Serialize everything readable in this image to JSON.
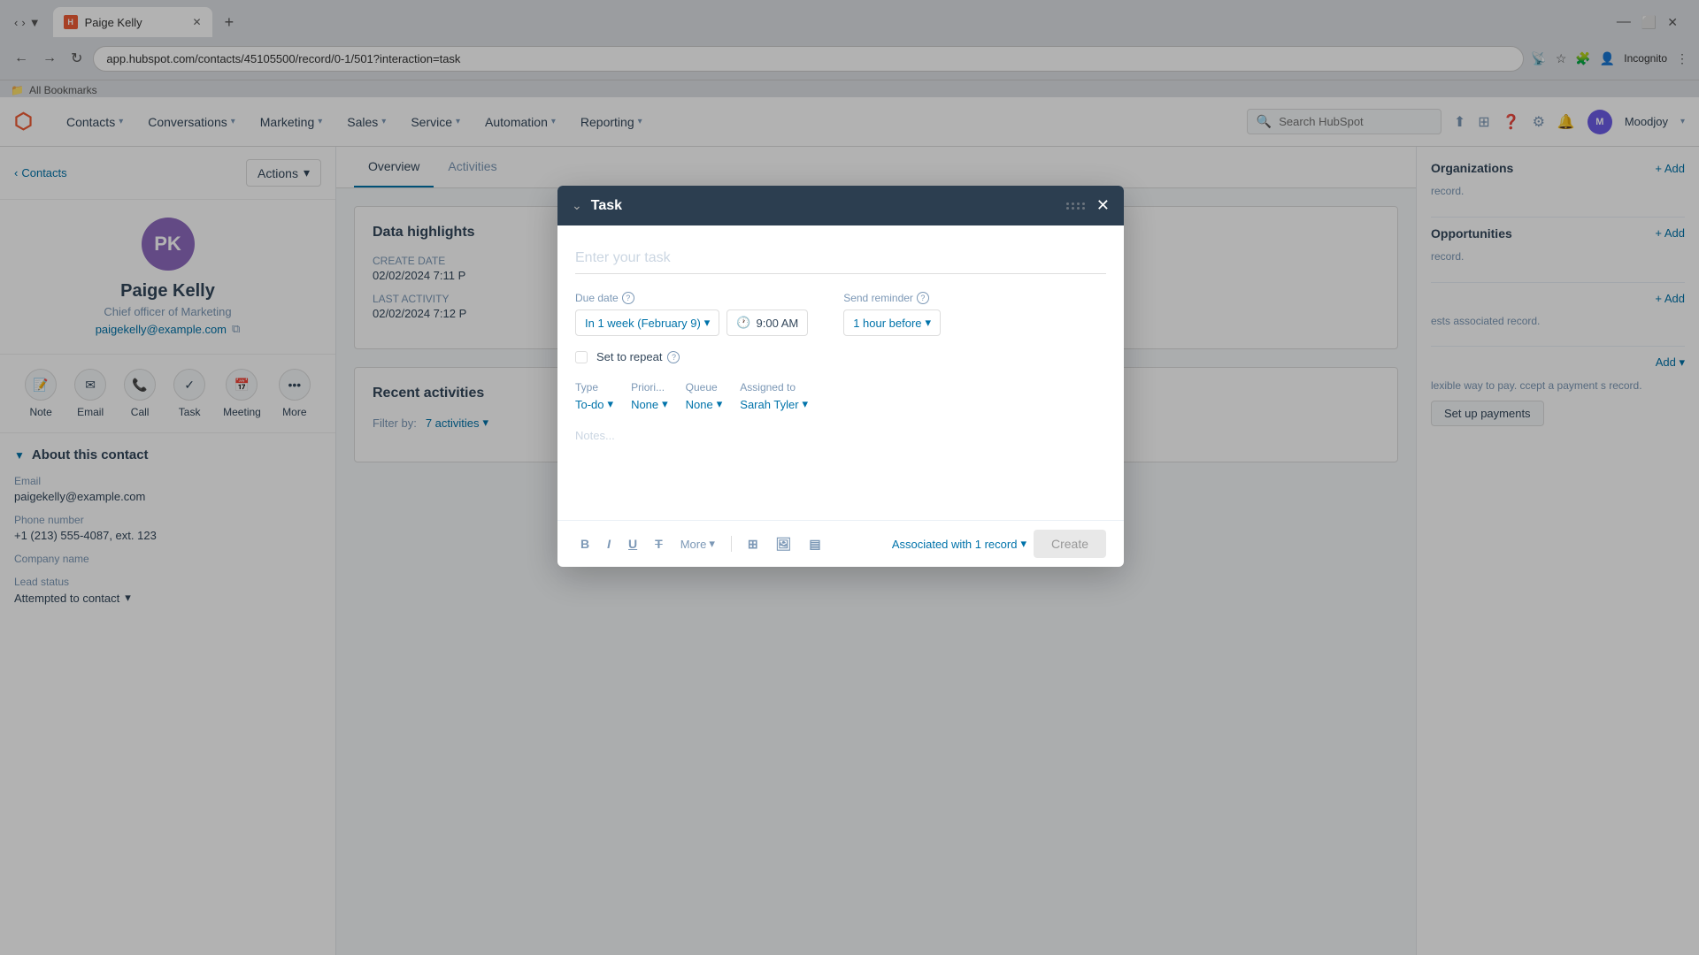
{
  "browser": {
    "tab_title": "Paige Kelly",
    "url": "app.hubspot.com/contacts/45105500/record/0-1/501?interaction=task",
    "new_tab_symbol": "+",
    "incognito_label": "Incognito",
    "bookmarks_label": "All Bookmarks"
  },
  "nav": {
    "logo": "⬡",
    "items": [
      {
        "label": "Contacts",
        "id": "contacts"
      },
      {
        "label": "Conversations",
        "id": "conversations"
      },
      {
        "label": "Marketing",
        "id": "marketing"
      },
      {
        "label": "Sales",
        "id": "sales"
      },
      {
        "label": "Service",
        "id": "service"
      },
      {
        "label": "Automation",
        "id": "automation"
      },
      {
        "label": "Reporting",
        "id": "reporting"
      }
    ],
    "search_placeholder": "Search HubSpot",
    "user_initials": "M",
    "user_name": "Moodjoy"
  },
  "sidebar": {
    "back_label": "Contacts",
    "actions_label": "Actions",
    "contact": {
      "initials": "PK",
      "name": "Paige Kelly",
      "title": "Chief officer of Marketing",
      "email": "paigekelly@example.com"
    },
    "quick_actions": [
      {
        "id": "note",
        "label": "Note",
        "icon": "📝"
      },
      {
        "id": "email",
        "label": "Email",
        "icon": "✉"
      },
      {
        "id": "call",
        "label": "Call",
        "icon": "📞"
      },
      {
        "id": "task",
        "label": "Task",
        "icon": "✓"
      },
      {
        "id": "meeting",
        "label": "Meeting",
        "icon": "📅"
      },
      {
        "id": "more",
        "label": "More",
        "icon": "•••"
      }
    ],
    "about_title": "About this contact",
    "fields": [
      {
        "label": "Email",
        "value": "paigekelly@example.com"
      },
      {
        "label": "Phone number",
        "value": "+1 (213) 555-4087, ext. 123"
      },
      {
        "label": "Company name",
        "value": ""
      },
      {
        "label": "Lead status",
        "value": "Attempted to contact"
      }
    ]
  },
  "main": {
    "tabs": [
      {
        "label": "Overview",
        "active": true
      },
      {
        "label": "Activities",
        "active": false
      }
    ],
    "data_highlights": {
      "title": "Data highlights",
      "fields": [
        {
          "label": "CREATE DATE",
          "value": "02/02/2024 7:11 P"
        },
        {
          "label": "LAST ACTIVITY",
          "value": "02/02/2024 7:12 P"
        }
      ]
    },
    "recent_activities": {
      "title": "Recent activities",
      "filter_label": "Filter by:",
      "filter_value": "7 activities"
    }
  },
  "right_panel": {
    "sections": [
      {
        "title": "Organizations",
        "text": "record.",
        "add_label": "+ Add"
      },
      {
        "title": "Opportunities",
        "text": "record.",
        "add_label": "+ Add"
      },
      {
        "title": "",
        "text": "ests associated record.",
        "add_label": "+ Add"
      },
      {
        "title": "",
        "text": "lexible way to pay.\nccept a payment\ns record.",
        "add_label": "Add"
      }
    ]
  },
  "task_modal": {
    "title": "Task",
    "task_placeholder": "Enter your task",
    "due_date_label": "Due date",
    "due_date_value": "In 1 week (February 9)",
    "time_value": "9:00 AM",
    "time_icon": "🕐",
    "send_reminder_label": "Send reminder",
    "reminder_value": "1 hour before",
    "repeat_label": "Set to repeat",
    "type_label": "Type",
    "type_value": "To-do",
    "priority_label": "Priori...",
    "priority_value": "None",
    "queue_label": "Queue",
    "queue_value": "None",
    "assigned_label": "Assigned to",
    "assigned_value": "Sarah Tyler",
    "notes_placeholder": "Notes...",
    "toolbar": {
      "bold": "B",
      "italic": "I",
      "underline": "U",
      "strikethrough": "T",
      "more_label": "More",
      "icon1": "⊞",
      "icon2": "🖼",
      "icon3": "▤"
    },
    "associated_label": "Associated with 1 record",
    "create_label": "Create"
  }
}
